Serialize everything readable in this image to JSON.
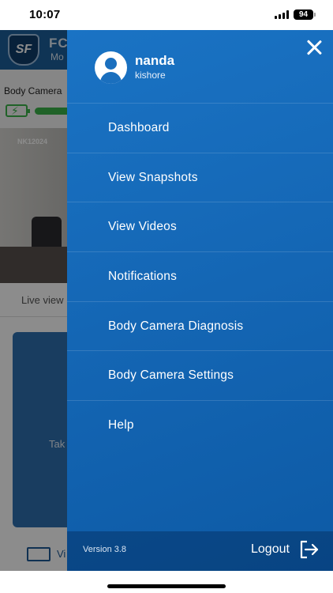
{
  "status_bar": {
    "time": "10:07",
    "battery": "94"
  },
  "background_app": {
    "app_name": "FC",
    "app_name_sub": "Mo",
    "logo_text": "SF",
    "device_label": "Body Camera",
    "feed_timestamp": "NK12024",
    "live_view_label": "Live view",
    "snap_card_text": "Tak",
    "bottom_label": "Vi"
  },
  "drawer": {
    "user": {
      "name": "nanda",
      "subtitle": "kishore"
    },
    "menu": [
      {
        "label": "Dashboard"
      },
      {
        "label": "View Snapshots"
      },
      {
        "label": "View Videos"
      },
      {
        "label": "Notifications"
      },
      {
        "label": "Body Camera Diagnosis"
      },
      {
        "label": "Body Camera Settings"
      },
      {
        "label": "Help"
      }
    ],
    "version": "Version 3.8",
    "logout_label": "Logout"
  },
  "icons": {
    "close": "close-icon",
    "avatar": "user-avatar-icon",
    "logout": "logout-icon",
    "charge": "battery-charging-icon",
    "snapshot": "image-icon"
  },
  "colors": {
    "drawer_bg": "#1466b4",
    "header_bg": "#1c5f9c",
    "battery_green": "#3bb34a"
  }
}
